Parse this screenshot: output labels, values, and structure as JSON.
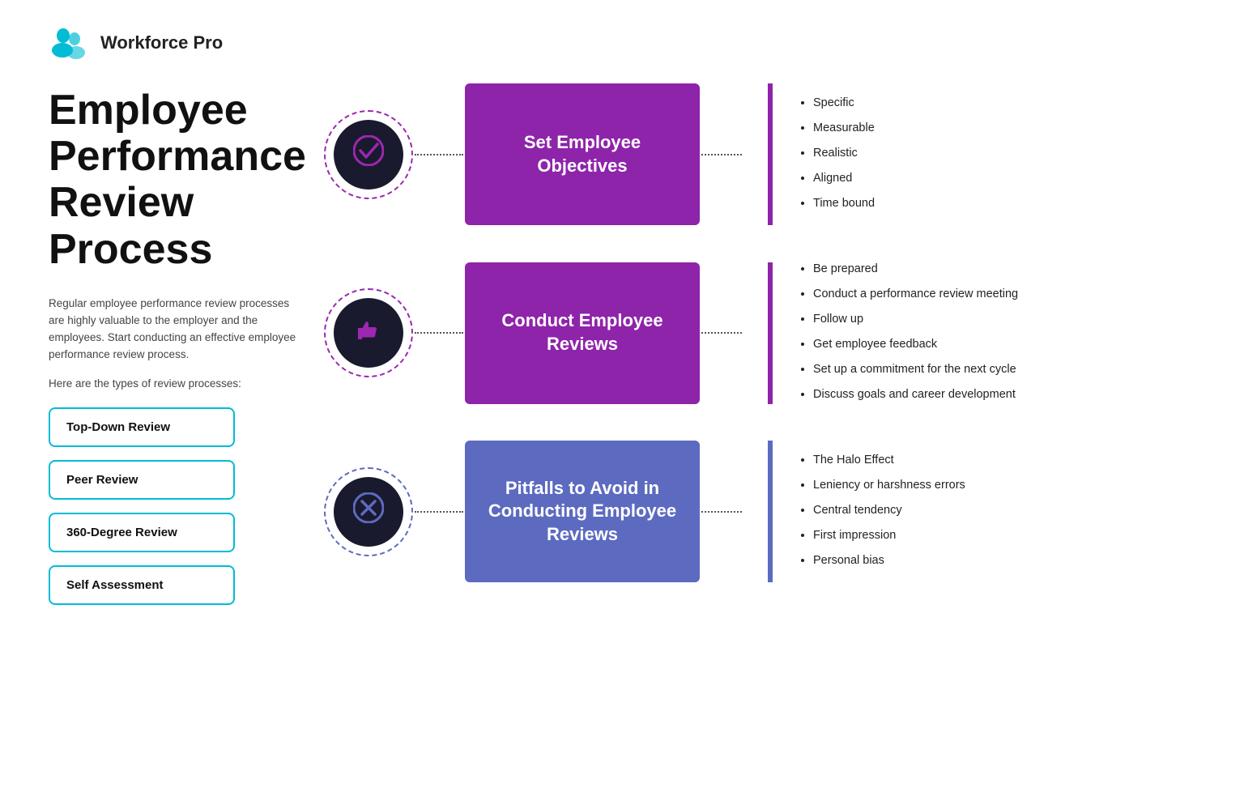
{
  "brand": {
    "name": "Workforce Pro"
  },
  "page": {
    "title": "Employee Performance Review Process",
    "description": "Regular employee performance review processes are highly valuable to the employer and the employees. Start conducting an effective employee performance review process.",
    "review_types_intro": "Here are the types of review processes:"
  },
  "review_buttons": [
    {
      "label": "Top-Down Review"
    },
    {
      "label": "Peer Review"
    },
    {
      "label": "360-Degree Review"
    },
    {
      "label": "Self Assessment"
    }
  ],
  "processes": [
    {
      "icon": "✓",
      "icon_color": "purple",
      "box_color": "purple",
      "title": "Set Employee Objectives",
      "bullets": [
        "Specific",
        "Measurable",
        "Realistic",
        "Aligned",
        "Time bound"
      ]
    },
    {
      "icon": "👍",
      "icon_color": "purple",
      "box_color": "purple",
      "title": "Conduct Employee Reviews",
      "bullets": [
        "Be prepared",
        "Conduct a performance review meeting",
        "Follow up",
        "Get employee feedback",
        "Set up a commitment for the next cycle",
        "Discuss goals and career development"
      ]
    },
    {
      "icon": "✕",
      "icon_color": "indigo",
      "box_color": "indigo",
      "title": "Pitfalls to Avoid in Conducting Employee Reviews",
      "bullets": [
        "The Halo Effect",
        "Leniency or harshness errors",
        "Central tendency",
        "First impression",
        "Personal bias"
      ]
    }
  ],
  "colors": {
    "purple": "#8e24aa",
    "indigo": "#5c6bc0",
    "cyan": "#00bcd4"
  }
}
